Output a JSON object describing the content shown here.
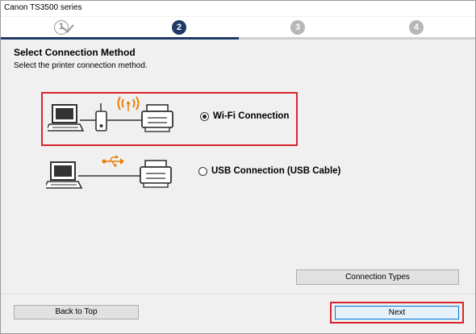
{
  "window": {
    "title": "Canon TS3500 series"
  },
  "steps": [
    {
      "number": "1",
      "state": "done"
    },
    {
      "number": "2",
      "state": "current"
    },
    {
      "number": "3",
      "state": "upcoming"
    },
    {
      "number": "4",
      "state": "upcoming"
    }
  ],
  "progress": {
    "current_step": 2,
    "total_steps": 4
  },
  "page": {
    "heading": "Select Connection Method",
    "subtitle": "Select the printer connection method."
  },
  "options": {
    "wifi": {
      "label": "Wi-Fi Connection",
      "selected": true,
      "icon": "wifi-icon"
    },
    "usb": {
      "label": "USB Connection (USB Cable)",
      "selected": false,
      "icon": "usb-icon"
    }
  },
  "buttons": {
    "connection_types": "Connection Types",
    "back_to_top": "Back to Top",
    "next": "Next"
  },
  "colors": {
    "accent": "#1f3a66",
    "highlight_border": "#d9262e",
    "signal_orange": "#f07d00"
  }
}
